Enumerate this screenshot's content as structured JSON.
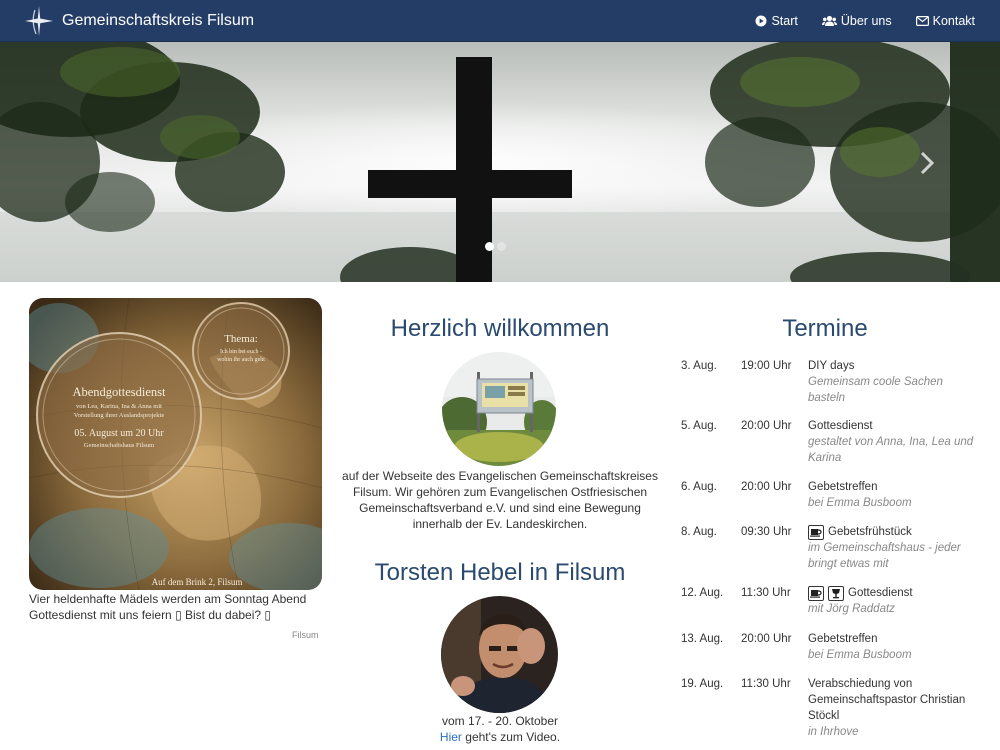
{
  "nav": {
    "brand": "Gemeinschaftskreis Filsum",
    "items": [
      {
        "label": "Start",
        "icon": "play-circle-icon"
      },
      {
        "label": "Über uns",
        "icon": "users-icon"
      },
      {
        "label": "Kontakt",
        "icon": "envelope-icon"
      }
    ]
  },
  "hero": {
    "slide_count": 2,
    "active_slide": 1
  },
  "poster": {
    "thema_title": "Thema:",
    "thema_text_1": "Ich bin bei euch -",
    "thema_text_2": "wohin ihr auch geht",
    "title": "Abendgottesdienst",
    "sub_1": "von Lea, Karina, Ina & Anna mit",
    "sub_2": "Vorstellung ihrer Auslandsprojekte",
    "date": "05. August um 20 Uhr",
    "location": "Gemeinschaftshaus Filsum",
    "address": "Auf dem Brink 2, Filsum",
    "caption": "Vier heldenhafte Mädels werden am Sonntag Abend Gottesdienst mit uns feiern ▯ Bist du dabei? ▯",
    "source": "Filsum"
  },
  "welcome": {
    "title": "Herzlich willkommen",
    "text": "auf der Webseite des Evangelischen Gemeinschaftskreises Filsum. Wir gehören zum Evangelischen Ostfriesischen Gemeinschaftsverband e.V. und sind eine Bewegung innerhalb der Ev. Landeskirchen."
  },
  "hebel": {
    "title": "Torsten Hebel in Filsum",
    "date": "vom 17. - 20. Oktober",
    "link": "Hier",
    "link_suffix": " geht's zum Video."
  },
  "termine": {
    "title": "Termine",
    "events": [
      {
        "date": "3. Aug.",
        "time": "19:00 Uhr",
        "title": "DIY days",
        "sub": "Gemeinsam coole Sachen basteln",
        "icons": []
      },
      {
        "date": "5. Aug.",
        "time": "20:00 Uhr",
        "title": "Gottesdienst",
        "sub": "gestaltet von Anna, Ina, Lea und Karina",
        "icons": []
      },
      {
        "date": "6. Aug.",
        "time": "20:00 Uhr",
        "title": "Gebetstreffen",
        "sub": "bei Emma Busboom",
        "icons": []
      },
      {
        "date": "8. Aug.",
        "time": "09:30 Uhr",
        "title": "Gebetsfrühstück",
        "sub": "im Gemeinschaftshaus - jeder bringt etwas mit",
        "icons": [
          "coffee-icon"
        ]
      },
      {
        "date": "12. Aug.",
        "time": "11:30 Uhr",
        "title": "Gottesdienst",
        "sub": "mit Jörg Raddatz",
        "icons": [
          "coffee-icon",
          "cup-icon"
        ]
      },
      {
        "date": "13. Aug.",
        "time": "20:00 Uhr",
        "title": "Gebetstreffen",
        "sub": "bei Emma Busboom",
        "icons": []
      },
      {
        "date": "19. Aug.",
        "time": "11:30 Uhr",
        "title": "Verabschiedung von Gemeinschaftspastor Christian Stöckl",
        "sub": "in Ihrhove",
        "icons": []
      }
    ]
  }
}
